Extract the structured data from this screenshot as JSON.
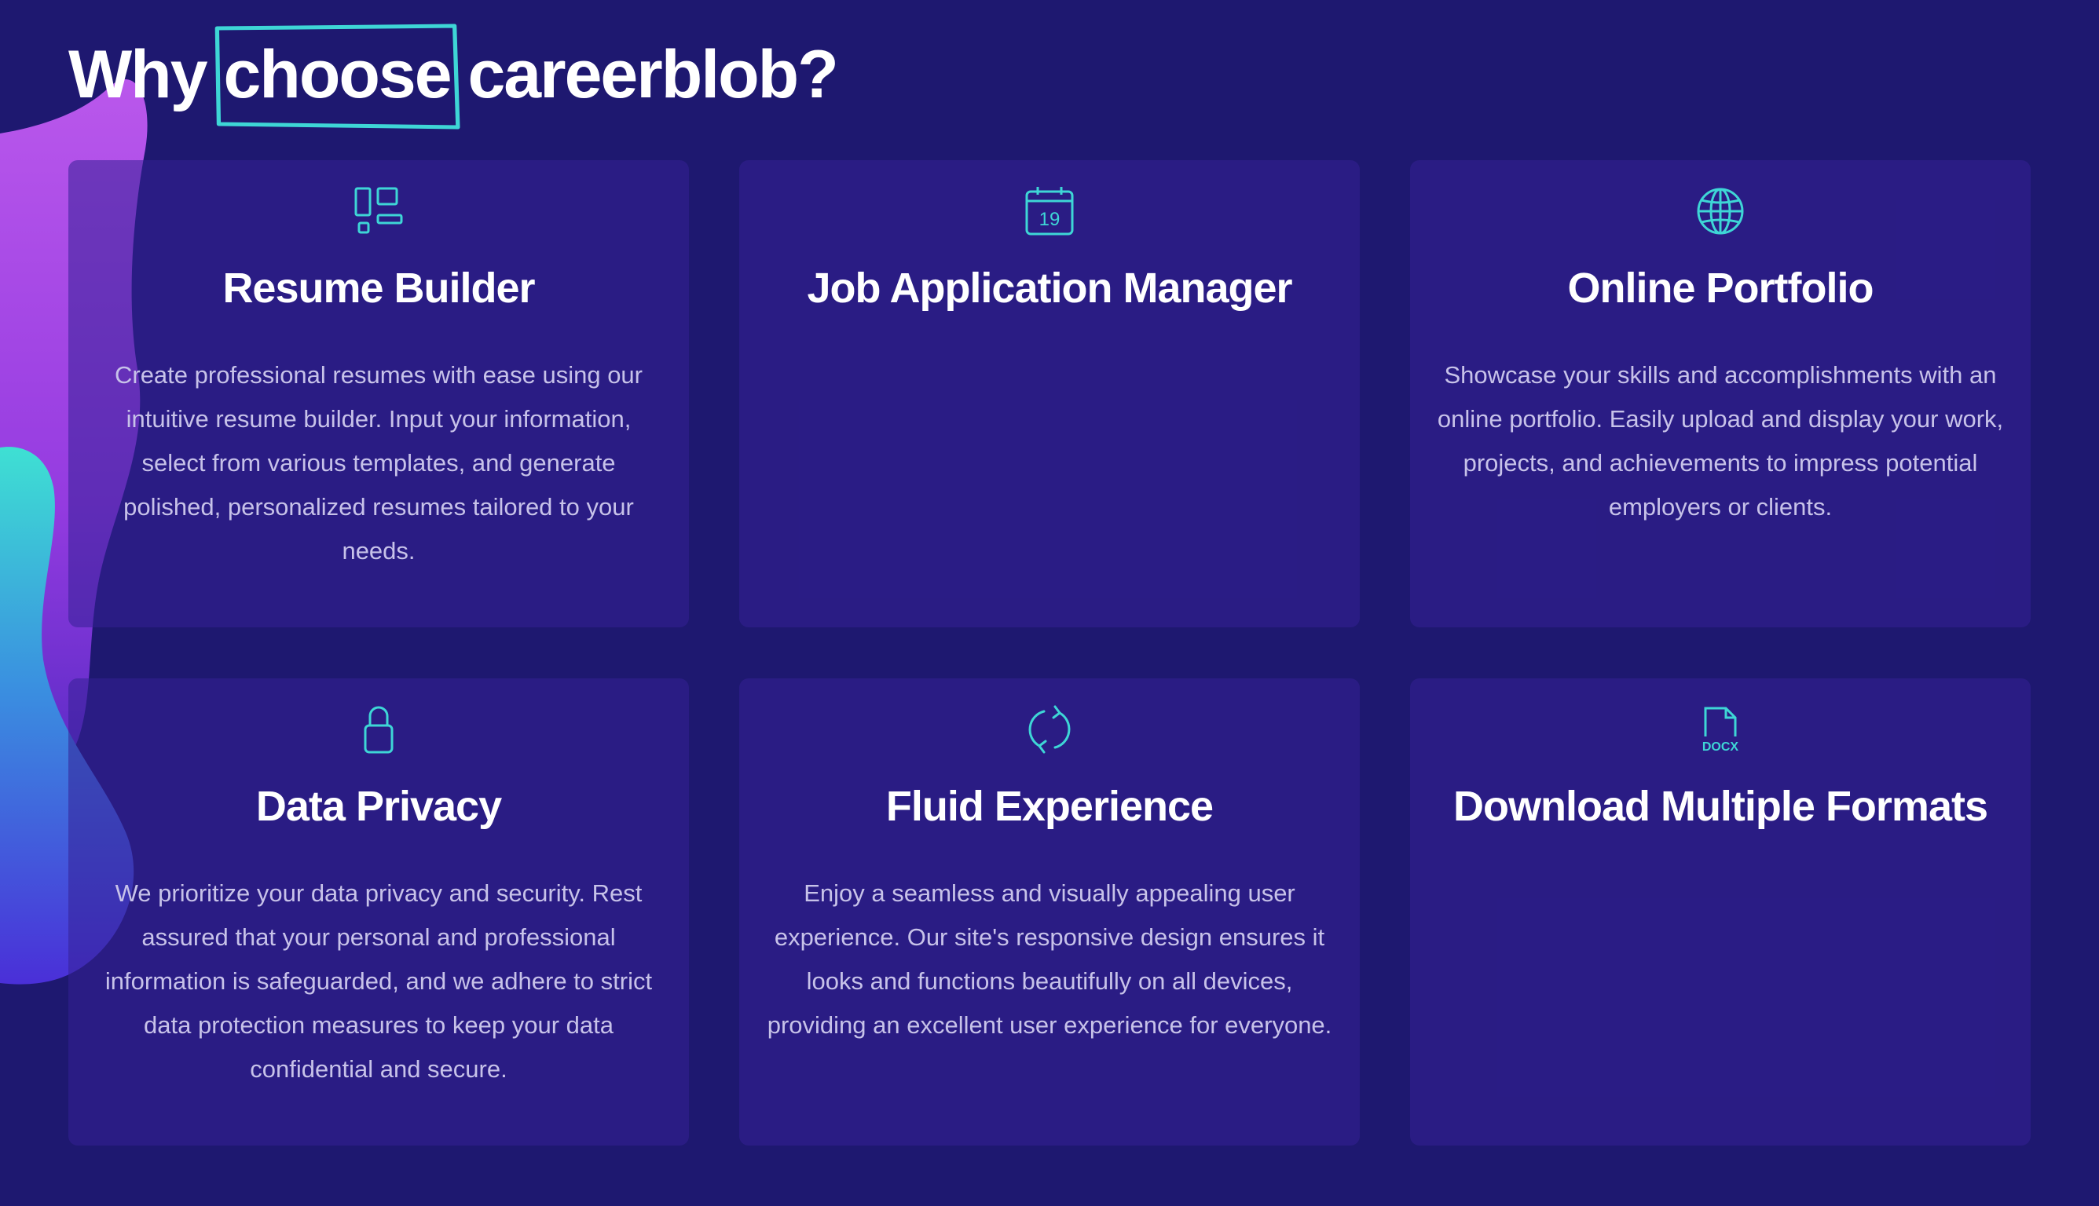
{
  "heading": {
    "before": "Why",
    "highlight": "choose",
    "after": "careerblob?"
  },
  "colors": {
    "background": "#1e1870",
    "card": "#2a1e85",
    "accent": "#3ed6d6",
    "title": "#ffffff",
    "body_text": "#c7c2e9"
  },
  "features": [
    {
      "icon": "layout-dashboard-icon",
      "title": "Resume Builder",
      "description": "Create professional resumes with ease using our intuitive resume builder. Input your information, select from various templates, and generate polished, personalized resumes tailored to your needs."
    },
    {
      "icon": "calendar-icon",
      "icon_text": "19",
      "title": "Job Application Manager",
      "description": ""
    },
    {
      "icon": "globe-icon",
      "title": "Online Portfolio",
      "description": "Showcase your skills and accomplishments with an online portfolio. Easily upload and display your work, projects, and achievements to impress potential employers or clients."
    },
    {
      "icon": "lock-icon",
      "title": "Data Privacy",
      "description": "We prioritize your data privacy and security. Rest assured that your personal and professional information is safeguarded, and we adhere to strict data protection measures to keep your data confidential and secure."
    },
    {
      "icon": "refresh-icon",
      "title": "Fluid Experience",
      "description": "Enjoy a seamless and visually appealing user experience. Our site's responsive design ensures it looks and functions beautifully on all devices, providing an excellent user experience for everyone."
    },
    {
      "icon": "docx-file-icon",
      "icon_text": "DOCX",
      "title": "Download Multiple Formats",
      "description": ""
    }
  ]
}
